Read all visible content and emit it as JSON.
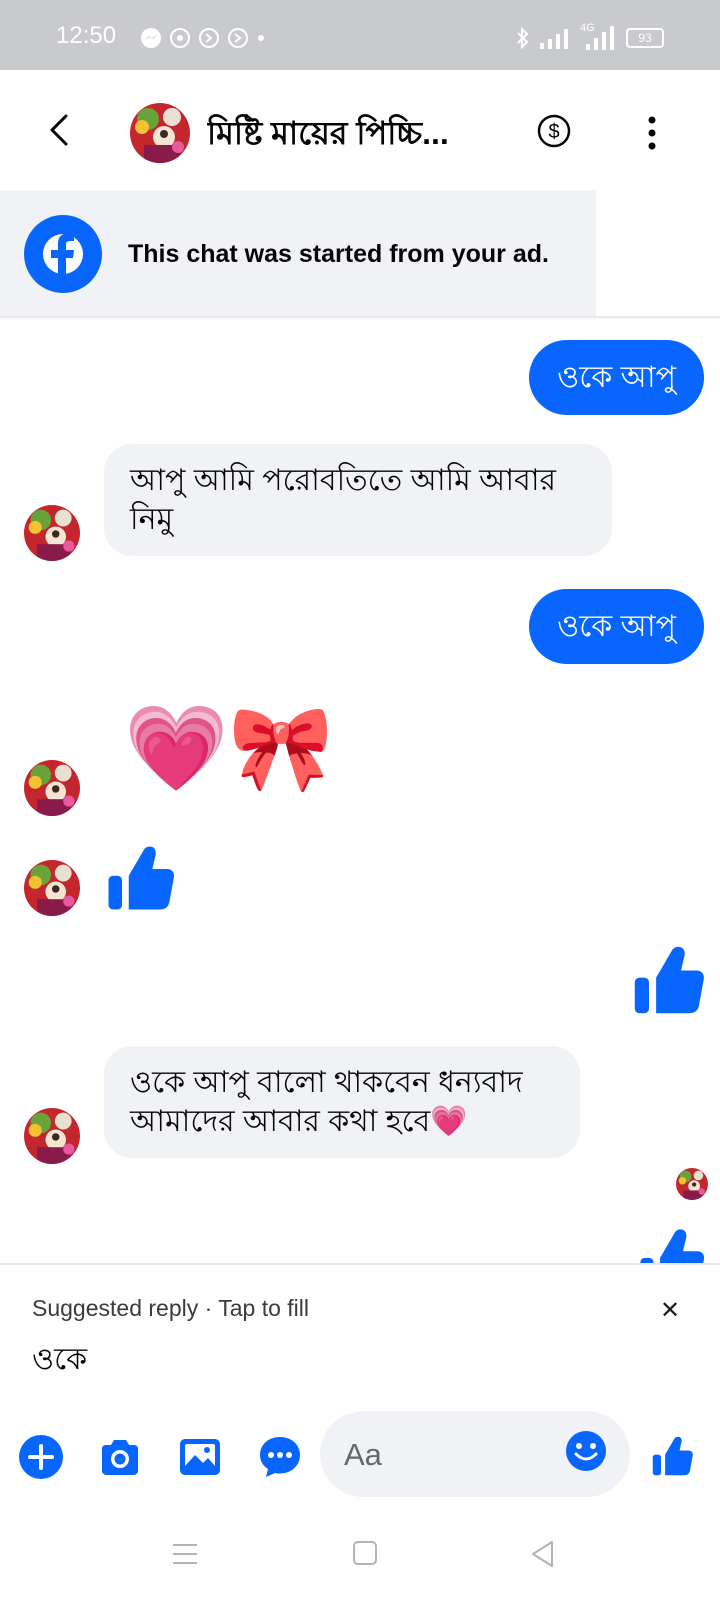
{
  "status_bar": {
    "time": "12:50",
    "network": "4G",
    "battery": "93",
    "left_icons": [
      "messenger-icon",
      "whatsapp-icon",
      "missed-call-icon",
      "missed-call-icon",
      "dot-icon"
    ],
    "right_icons": [
      "bluetooth-icon",
      "signal-icon",
      "signal-4g-icon",
      "battery-icon"
    ]
  },
  "header": {
    "title": "মিষ্টি মায়ের পিচ্চি...",
    "back_icon": "chevron-left-icon",
    "payment_icon": "dollar-circle-icon",
    "menu_icon": "more-vertical-icon"
  },
  "ad_banner": {
    "text": "This chat was started from your ad.",
    "icon": "facebook-logo-icon"
  },
  "messages": [
    {
      "side": "out",
      "type": "text",
      "text": "ওকে আপু"
    },
    {
      "side": "in",
      "type": "text",
      "line1": "আপু আমি পরোবতিতে আমি আবার",
      "line2": "নিমু"
    },
    {
      "side": "out",
      "type": "text",
      "text": "ওকে আপু"
    },
    {
      "side": "in",
      "type": "emoji",
      "text": "💗🎀"
    },
    {
      "side": "in",
      "type": "like",
      "icon": "thumbs-up-icon"
    },
    {
      "side": "out",
      "type": "like",
      "icon": "thumbs-up-icon"
    },
    {
      "side": "in",
      "type": "text",
      "line1": "ওকে আপু বালো থাকবেন ধন্যবাদ",
      "line2": "আমাদের আবার কথা হবে💗"
    },
    {
      "side": "out",
      "type": "like",
      "icon": "thumbs-up-icon"
    }
  ],
  "suggested_reply": {
    "label": "Suggested reply · Tap to fill",
    "text": "ওকে",
    "close": "✕"
  },
  "composer": {
    "placeholder": "Aa",
    "icons": [
      "plus-icon",
      "camera-icon",
      "gallery-icon",
      "chat-bubble-icon",
      "emoji-icon",
      "thumbs-up-icon"
    ]
  },
  "colors": {
    "accent": "#0866ff",
    "bubble_in": "#f0f2f5",
    "status_bar": "#c9cacd"
  },
  "nav_bar": {
    "icons": [
      "recents-icon",
      "home-icon",
      "back-icon"
    ]
  }
}
